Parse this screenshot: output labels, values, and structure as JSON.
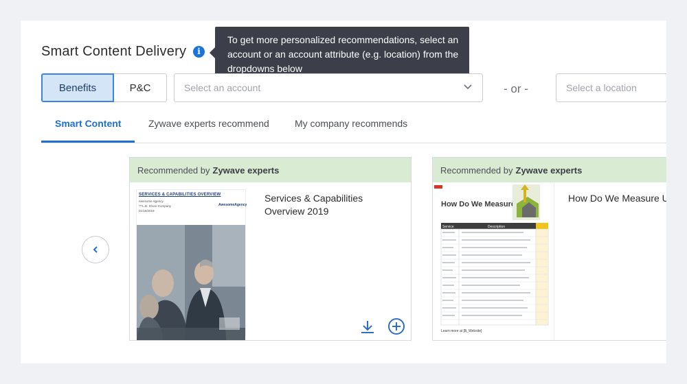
{
  "header": {
    "title": "Smart Content Delivery",
    "info_icon": "info-icon",
    "tooltip": "To get more personalized recommendations, select an account or an account attribute (e.g. location) from the dropdowns below"
  },
  "segmented": {
    "options": [
      "Benefits",
      "P&C"
    ],
    "selected": "Benefits"
  },
  "filters": {
    "account_placeholder": "Select an account",
    "or_label": "- or -",
    "location_placeholder": "Select a location"
  },
  "tabs": {
    "items": [
      "Smart Content",
      "Zywave experts recommend",
      "My company recommends"
    ],
    "active": "Smart Content"
  },
  "cards": [
    {
      "recommended_prefix": "Recommended by",
      "recommended_by": "Zywave experts",
      "title": "Services & Capabilities Overview 2019",
      "thumb": {
        "heading": "SERVICES & CAPABILITIES OVERVIEW",
        "line1": "Awesome Agency",
        "line2": "***L.B. Shore Company",
        "line3": "01/16/2019",
        "brand": "AwesomeAgency"
      }
    },
    {
      "recommended_prefix": "Recommended by",
      "recommended_by": "Zywave experts",
      "title": "How Do We Measure Up?",
      "thumb": {
        "heading": "How Do We Measure Up?",
        "table_header_service": "Service",
        "table_header_desc": "Description",
        "footer": "Learn more at [B_Website]"
      }
    }
  ],
  "colors": {
    "accent": "#1f6fcf",
    "tooltip_bg": "#3c3f4a",
    "card_header_bg": "#d9ecd3",
    "active_segment_bg": "#d5e5f8"
  }
}
